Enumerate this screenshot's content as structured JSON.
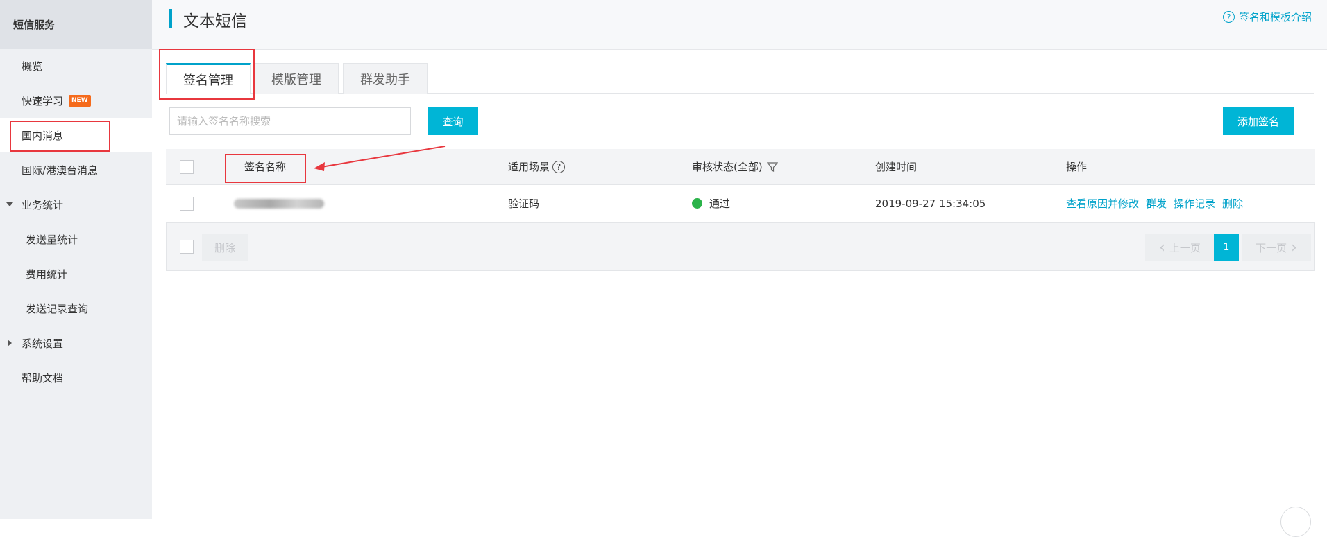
{
  "sidebar": {
    "title": "短信服务",
    "items": [
      {
        "label": "概览"
      },
      {
        "label": "快速学习",
        "badge": "NEW"
      },
      {
        "label": "国内消息"
      },
      {
        "label": "国际/港澳台消息"
      },
      {
        "label": "业务统计"
      },
      {
        "label": "发送量统计"
      },
      {
        "label": "费用统计"
      },
      {
        "label": "发送记录查询"
      },
      {
        "label": "系统设置"
      },
      {
        "label": "帮助文档"
      }
    ]
  },
  "header": {
    "title": "文本短信",
    "help_link": "签名和模板介绍"
  },
  "tabs": [
    {
      "label": "签名管理",
      "active": true
    },
    {
      "label": "模版管理",
      "active": false
    },
    {
      "label": "群发助手",
      "active": false
    }
  ],
  "toolbar": {
    "search_placeholder": "请输入签名名称搜索",
    "query_button": "查询",
    "add_button": "添加签名"
  },
  "table": {
    "columns": [
      "签名名称",
      "适用场景",
      "审核状态(全部)",
      "创建时间",
      "操作"
    ],
    "rows": [
      {
        "scene": "验证码",
        "status": "通过",
        "created": "2019-09-27 15:34:05",
        "actions": [
          "查看原因并修改",
          "群发",
          "操作记录",
          "删除"
        ]
      }
    ],
    "footer_delete": "删除"
  },
  "pagination": {
    "prev": "上一页",
    "current": "1",
    "next": "下一页"
  },
  "colors": {
    "accent": "#00b5d6",
    "link": "#00a2ca",
    "success": "#2bb34a",
    "highlight": "#e8373e"
  }
}
